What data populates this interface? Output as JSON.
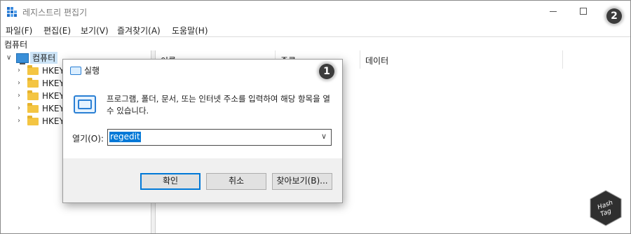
{
  "window": {
    "title": "레지스트리 편집기",
    "address": "컴퓨터"
  },
  "menu": [
    "파일(F)",
    "편집(E)",
    "보기(V)",
    "즐겨찾기(A)",
    "도움말(H)"
  ],
  "tree": {
    "root": "컴퓨터",
    "hives": [
      "HKEY_",
      "HKEY_",
      "HKEY_",
      "HKEY_",
      "HKEY_"
    ]
  },
  "columns": [
    "이름",
    "종류",
    "데이터"
  ],
  "dialog": {
    "title": "실행",
    "description": "프로그램, 폴더, 문서, 또는 인터넷 주소를 입력하여 해당 항목을 열 수 있습니다.",
    "open_label": "열기(O):",
    "open_value": "regedit",
    "ok_label": "확인",
    "cancel_label": "취소",
    "browse_label": "찾아보기(B)..."
  },
  "badges": [
    "1",
    "2"
  ],
  "watermark": "HashTag",
  "colors": {
    "accent": "#0078d7",
    "selection": "#cce4f7",
    "folder": "#f4c542",
    "badge": "#3c3c3c"
  }
}
